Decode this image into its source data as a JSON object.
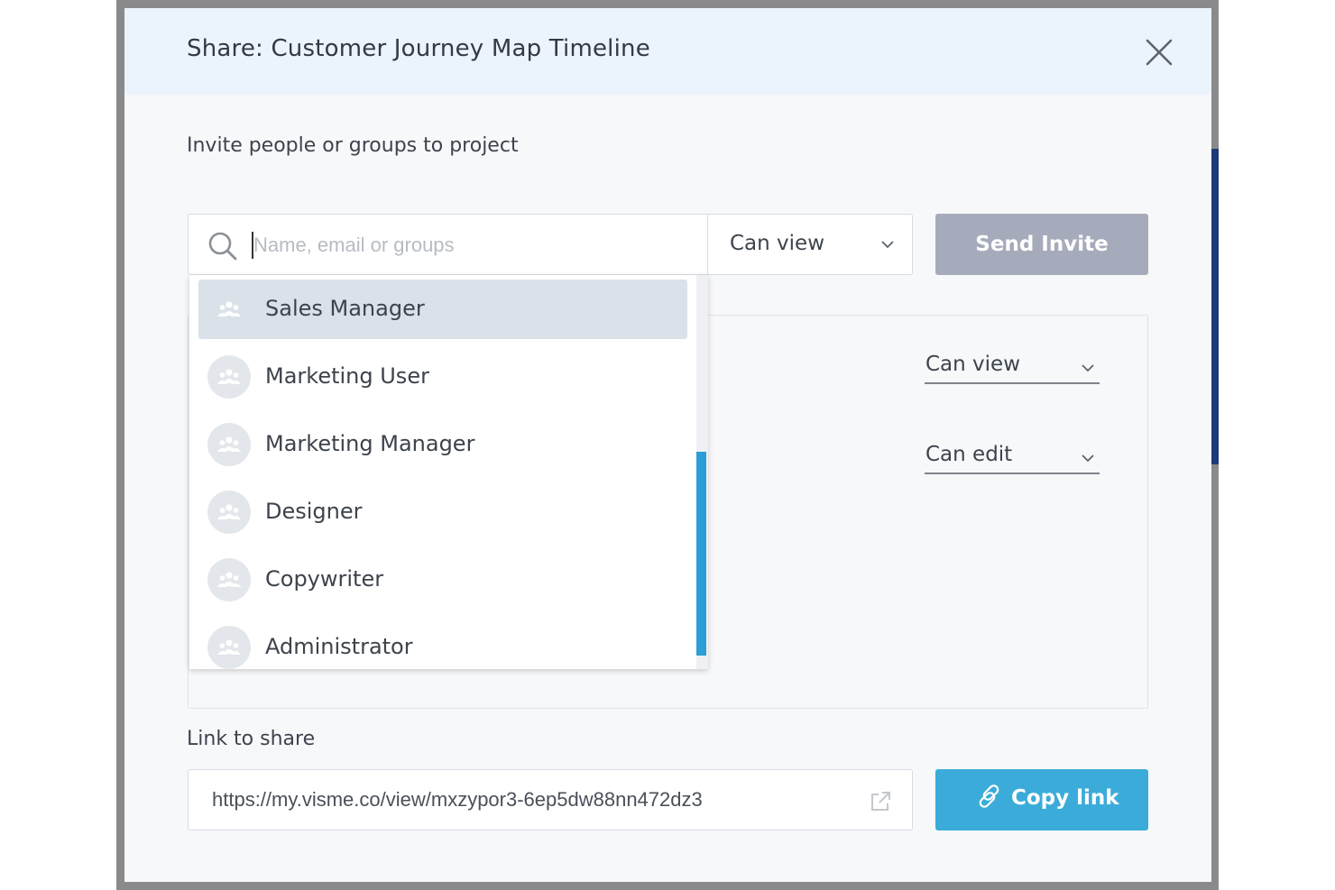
{
  "modal": {
    "title": "Share: Customer Journey Map Timeline"
  },
  "invite": {
    "label": "Invite people or groups to project",
    "search_placeholder": "Name, email or groups",
    "permission": "Can view",
    "send_label": "Send Invite"
  },
  "dropdown": {
    "items": [
      {
        "label": "Sales Manager",
        "active": true
      },
      {
        "label": "Marketing User"
      },
      {
        "label": "Marketing Manager"
      },
      {
        "label": "Designer"
      },
      {
        "label": "Copywriter"
      },
      {
        "label": "Administrator"
      }
    ]
  },
  "members": {
    "permissions": [
      "Can view",
      "Can edit"
    ]
  },
  "share_link": {
    "label": "Link to share",
    "url": "https://my.visme.co/view/mxzypor3-6ep5dw88nn472dz3",
    "copy_label": "Copy link"
  },
  "icons": {
    "close": "close-icon",
    "search": "search-icon",
    "chevron": "chevron-down-icon",
    "group": "group-icon",
    "external": "external-link-icon",
    "link": "link-icon"
  },
  "colors": {
    "header_bg": "#ebf3fc",
    "send_button_disabled": "#a6abbb",
    "copy_button": "#3bacd9",
    "scroll_thumb": "#2b9fd5",
    "active_item": "#dae1e9"
  }
}
